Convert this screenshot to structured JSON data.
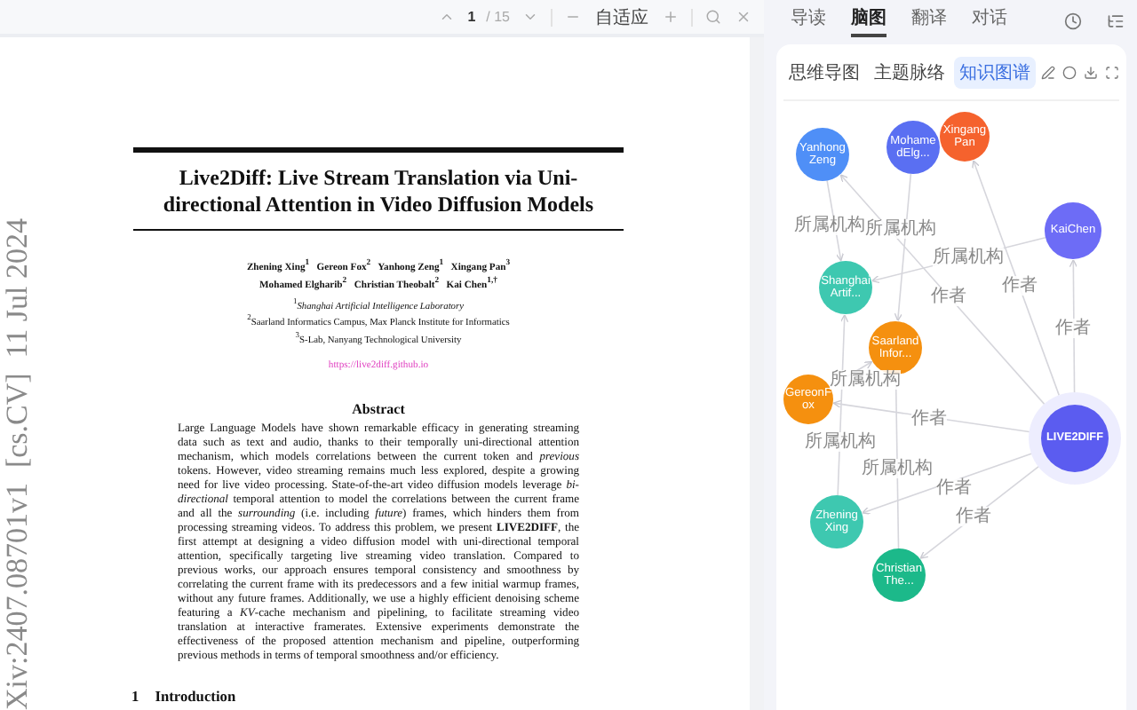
{
  "viewer_toolbar": {
    "page_current": "1",
    "page_total": "/ 15",
    "zoom_label": "自适应"
  },
  "paper": {
    "title": "Live2Diff: Live Stream Translation via Uni-directional Attention in Video Diffusion Models",
    "authors": [
      "Zhening Xing$^{1}$   Gereon Fox$^{2}$   Yanhong Zeng$^{1}$   Xingang Pan$^{3}$",
      "Mohamed Elgharib$^{2}$   Christian Theobalt$^{2}$   Kai Chen$^{1,†}$"
    ],
    "affiliations": [
      "$^{1}$*Shanghai Artificial Intelligence Laboratory*",
      "$^{2}$Saarland Informatics Campus, Max Planck Institute for Informatics",
      "$^{3}$S-Lab, Nanyang Technological University"
    ],
    "link": "https://live2diff.github.io",
    "abstract_heading": "Abstract",
    "abstract": "Large Language Models have shown remarkable efficacy in generating streaming data such as text and audio, thanks to their temporally uni-directional attention mechanism, which models correlations between the current token and *previous* tokens. However, video streaming remains much less explored, despite a growing need for live video processing. State-of-the-art video diffusion models leverage *bi-directional* temporal attention to model the correlations between the current frame and all the *surrounding* (i.e. including *future*) frames, which hinders them from processing streaming videos. To address this problem, we present **LIVE2DIFF**, the first attempt at designing a video diffusion model with uni-directional temporal attention, specifically targeting live streaming video translation. Compared to previous works, our approach ensures temporal consistency and smoothness by correlating the current frame with its predecessors and a few initial warmup frames, without any future frames. Additionally, we use a highly efficient denoising scheme featuring a *KV*-cache mechanism and pipelining, to facilitate streaming video translation at interactive framerates. Extensive experiments demonstrate the effectiveness of the proposed attention mechanism and pipeline, outperforming previous methods in terms of temporal smoothness and/or efficiency.",
    "section_number": "1",
    "section_title": "Introduction",
    "side_stamp": "Xiv:2407.08701v1  [cs.CV]  11 Jul 2024"
  },
  "panel_tabs": [
    {
      "label": "导读",
      "selected": false
    },
    {
      "label": "脑图",
      "selected": true
    },
    {
      "label": "翻译",
      "selected": false
    },
    {
      "label": "对话",
      "selected": false
    }
  ],
  "view_tabs": [
    {
      "label": "思维导图",
      "selected": false
    },
    {
      "label": "主题脉络",
      "selected": false
    },
    {
      "label": "知识图谱",
      "selected": true
    }
  ],
  "graph": {
    "nodes": [
      {
        "label": "YanhongZeng",
        "kind": "entity",
        "color": "#4f8ff7"
      },
      {
        "label": "MohamedElg...",
        "kind": "entity",
        "color": "#5a6ff2"
      },
      {
        "label": "XingangPan",
        "kind": "entity",
        "color": "#f5622d"
      },
      {
        "label": "KaiChen",
        "kind": "entity",
        "color": "#6d6cf6"
      },
      {
        "label": "ShanghaiArtif...",
        "kind": "entity",
        "color": "#3ec8b0"
      },
      {
        "label": "SaarlandInfor...",
        "kind": "entity",
        "color": "#f5900f"
      },
      {
        "label": "GereonFox",
        "kind": "entity",
        "color": "#f5900f"
      },
      {
        "label": "LIVE2DIFF",
        "kind": "paper",
        "color": "#5b5cf0"
      },
      {
        "label": "Zhening Xing",
        "kind": "entity",
        "color": "#3ec8b0"
      },
      {
        "label": "ChristianThe...",
        "kind": "entity",
        "color": "#1cb98a"
      }
    ],
    "edges": [
      {
        "label": "所属机构"
      },
      {
        "label": "所属机构"
      },
      {
        "label": "所属机构"
      },
      {
        "label": "作者"
      },
      {
        "label": "作者"
      },
      {
        "label": "作者"
      },
      {
        "label": "所属机构"
      },
      {
        "label": "所属机构"
      },
      {
        "label": "作者"
      },
      {
        "label": "所属机构"
      },
      {
        "label": "作者"
      },
      {
        "label": "作者"
      }
    ]
  }
}
